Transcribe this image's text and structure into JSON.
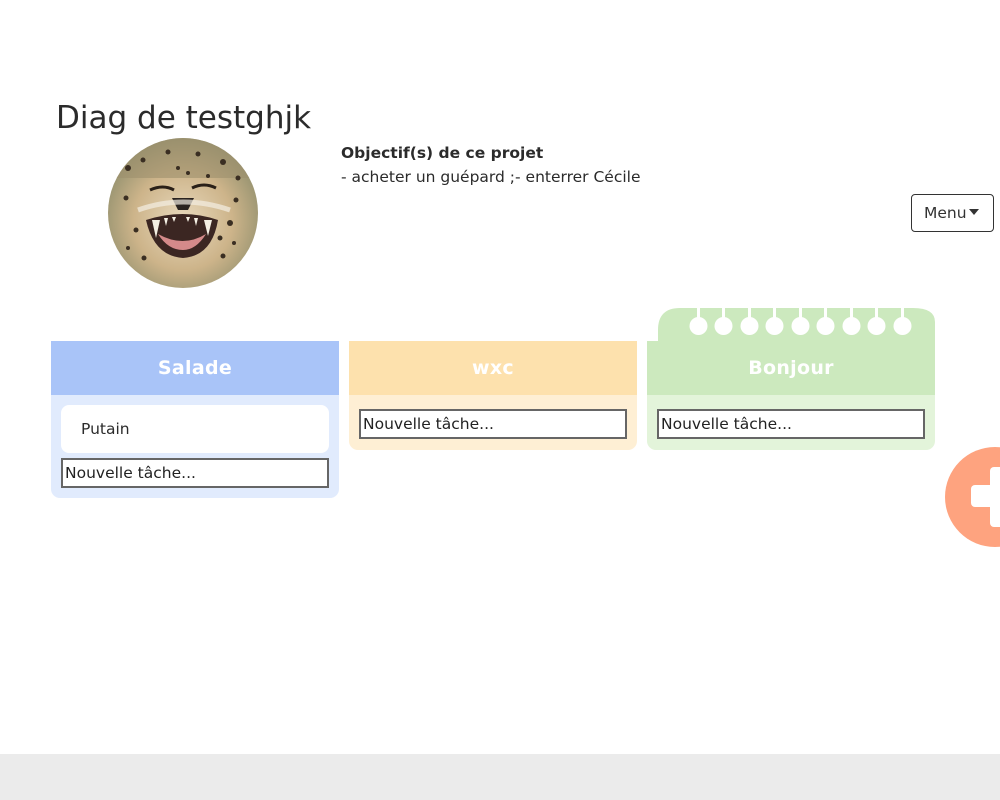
{
  "project": {
    "title": "Diag de testghjk",
    "objectives_heading": "Objectif(s) de ce projet",
    "objectives_text": "- acheter un guépard ;- enterrer Cécile"
  },
  "menu": {
    "label": "Menu"
  },
  "columns": [
    {
      "title": "Salade",
      "color": "#a9c4f8",
      "tasks": [
        "Putain"
      ],
      "new_task_placeholder": "Nouvelle tâche..."
    },
    {
      "title": "wxc",
      "color": "#fde1ad",
      "tasks": [],
      "new_task_placeholder": "Nouvelle tâche..."
    },
    {
      "title": "Bonjour",
      "color": "#cce9be",
      "tasks": [],
      "new_task_placeholder": "Nouvelle tâche..."
    }
  ],
  "fab": {
    "icon": "plus-icon",
    "color": "#fea37f"
  },
  "avatar": {
    "icon": "cheetah-avatar"
  }
}
